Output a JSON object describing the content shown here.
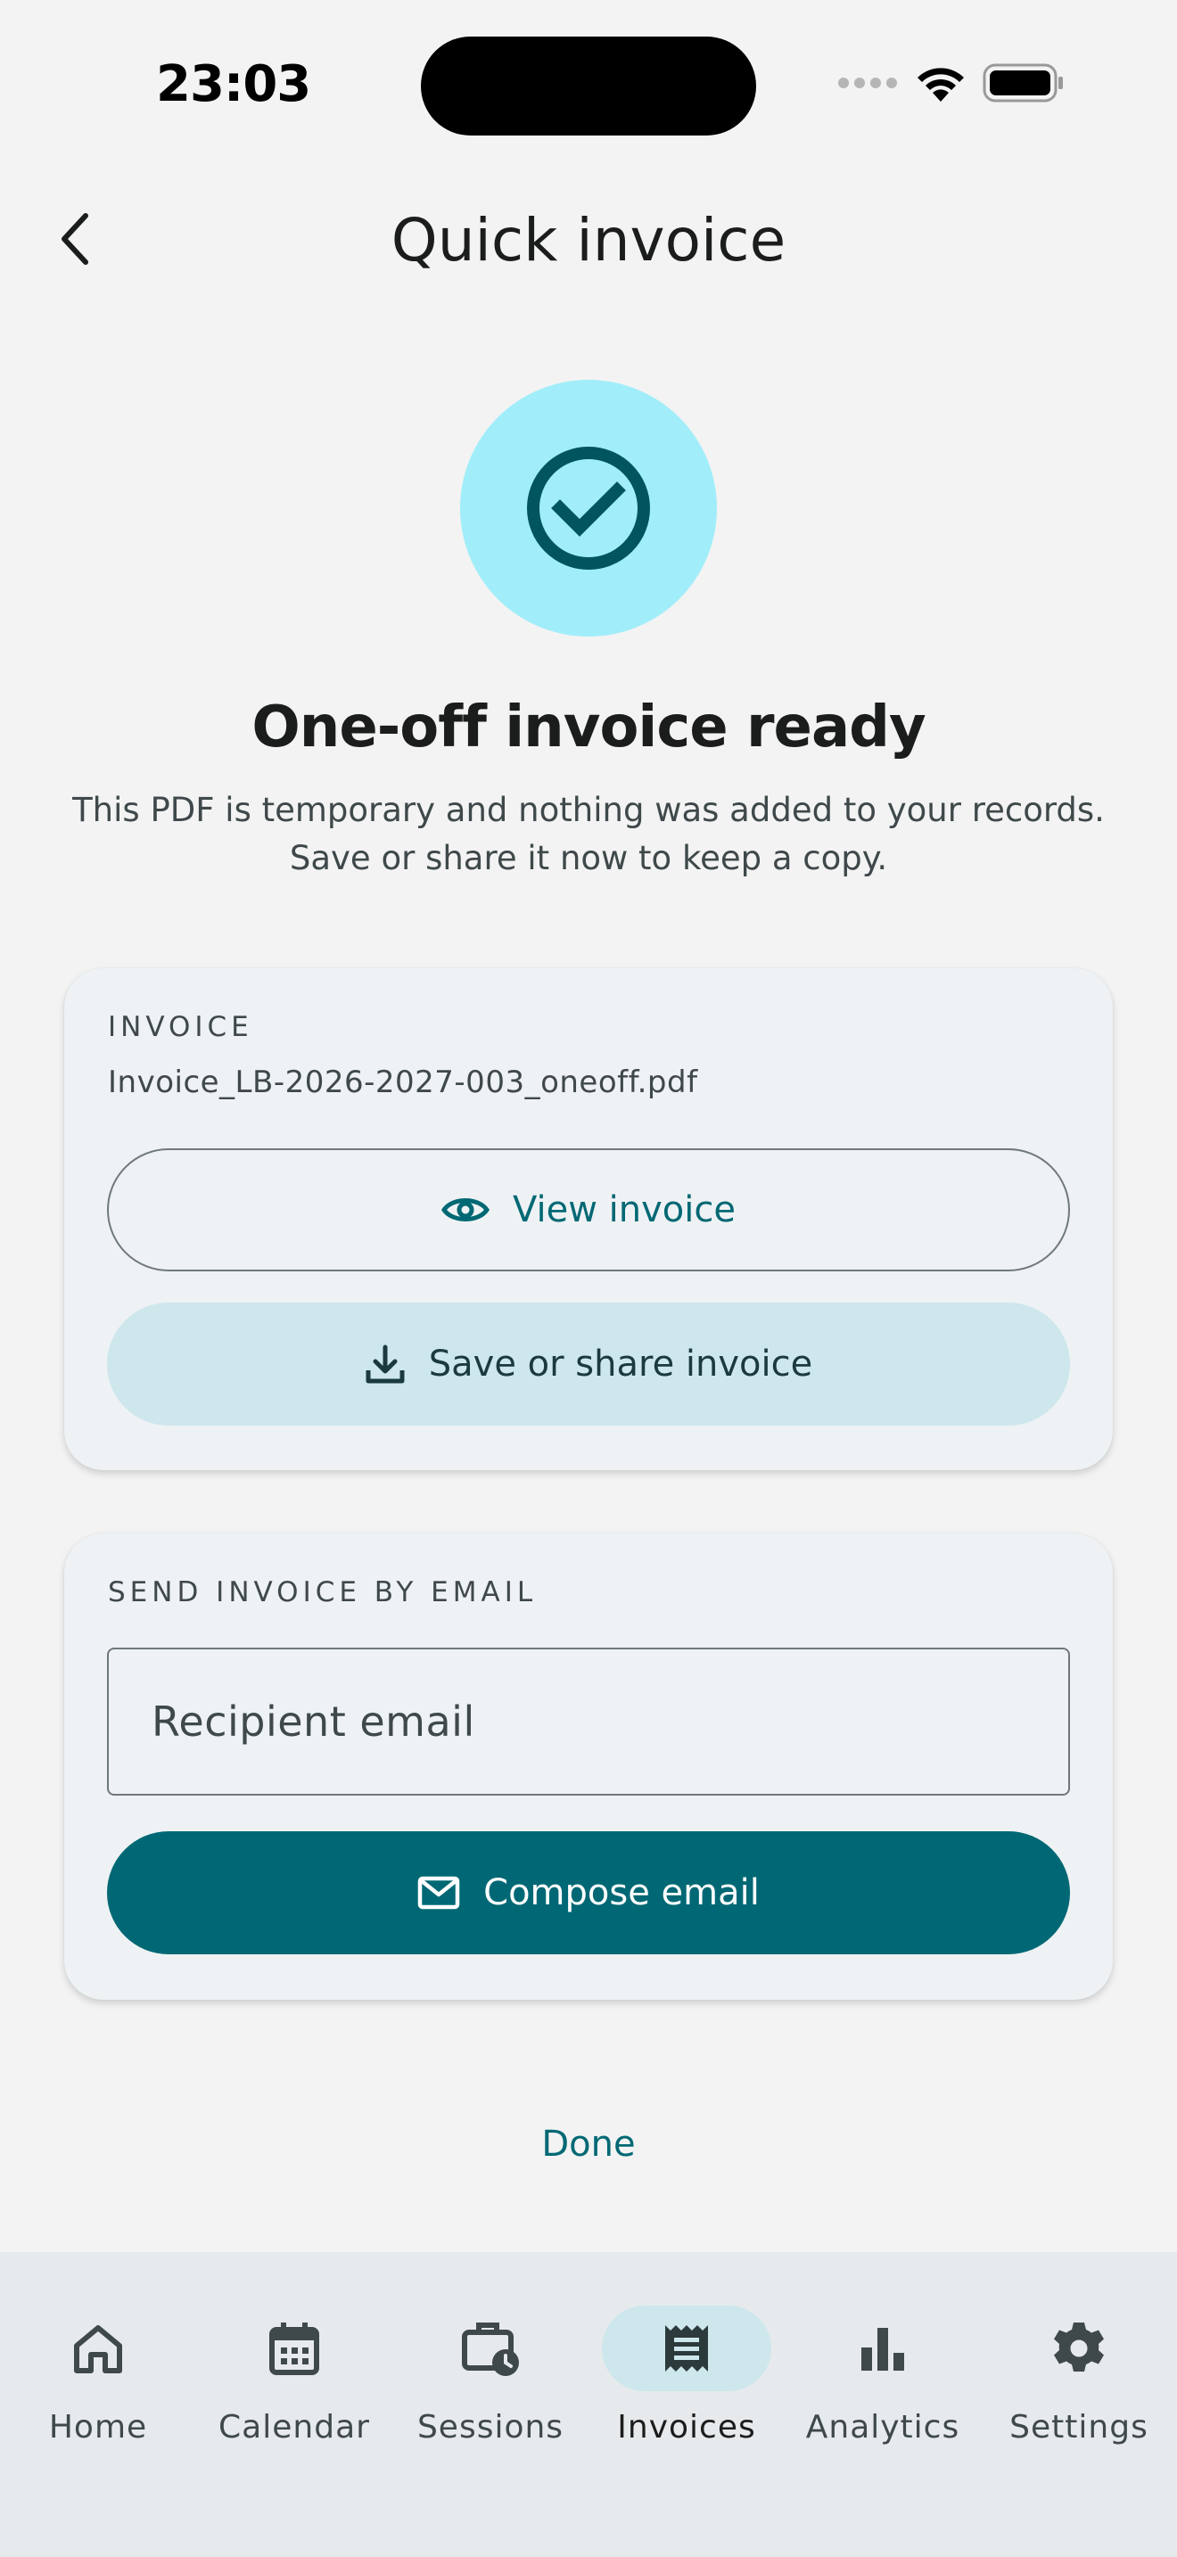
{
  "status_bar": {
    "time": "23:03"
  },
  "app_bar": {
    "title": "Quick invoice"
  },
  "success": {
    "headline": "One-off invoice ready",
    "subtitle": "This PDF is temporary and nothing was added to your records.\nSave or share it now to keep a copy."
  },
  "invoice_card": {
    "label": "INVOICE",
    "filename": "Invoice_LB-2026-2027-003_oneoff.pdf",
    "view_button": "View invoice",
    "save_button": "Save or share invoice"
  },
  "email_card": {
    "label": "SEND INVOICE BY EMAIL",
    "email_placeholder": "Recipient email",
    "compose_button": "Compose email"
  },
  "done_label": "Done",
  "bottom_nav": {
    "items": [
      {
        "label": "Home",
        "icon": "home-icon"
      },
      {
        "label": "Calendar",
        "icon": "calendar-icon"
      },
      {
        "label": "Sessions",
        "icon": "sessions-icon"
      },
      {
        "label": "Invoices",
        "icon": "receipt-icon",
        "active": true
      },
      {
        "label": "Analytics",
        "icon": "bar-chart-icon"
      },
      {
        "label": "Settings",
        "icon": "gear-icon"
      }
    ]
  },
  "colors": {
    "primary": "#006874",
    "success_circle": "#a1eefa",
    "tonal": "#cde7ec",
    "background": "#f3f3f3"
  }
}
